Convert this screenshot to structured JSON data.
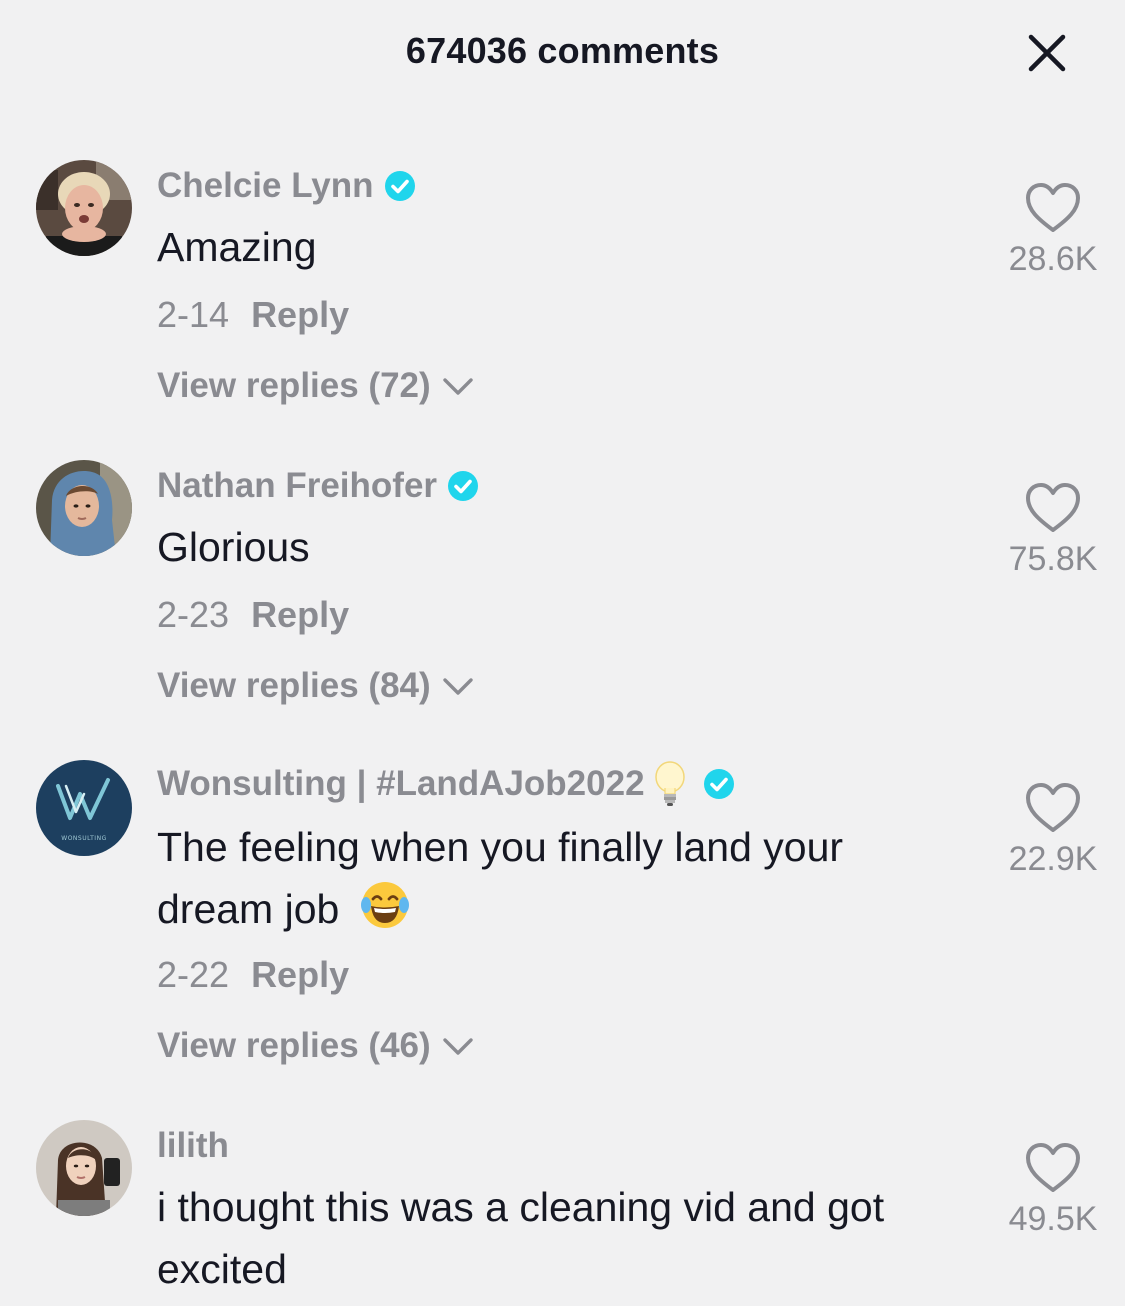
{
  "header": {
    "title": "674036 comments",
    "close_icon": "close-icon"
  },
  "colors": {
    "background": "#f1f1f2",
    "text_primary": "#161823",
    "text_secondary": "#8a8b91",
    "verified_badge": "#20d5ec"
  },
  "comments": [
    {
      "username": "Chelcie Lynn",
      "verified": true,
      "text": "Amazing",
      "date": "2-14",
      "reply_label": "Reply",
      "view_replies": "View replies (72)",
      "likes": "28.6K"
    },
    {
      "username": "Nathan Freihofer",
      "verified": true,
      "text": "Glorious",
      "date": "2-23",
      "reply_label": "Reply",
      "view_replies": "View replies (84)",
      "likes": "75.8K"
    },
    {
      "username": "Wonsulting | #LandAJob2022",
      "verified": true,
      "username_emoji": "light-bulb-icon",
      "text": "The feeling when you finally land your dream job",
      "text_emoji": "laughing-tears-emoji",
      "date": "2-22",
      "reply_label": "Reply",
      "view_replies": "View replies (46)",
      "likes": "22.9K",
      "avatar_logo_text": "WONSULTING"
    },
    {
      "username": "lilith",
      "verified": false,
      "text": "i thought this was a cleaning vid and got excited",
      "likes": "49.5K"
    }
  ]
}
